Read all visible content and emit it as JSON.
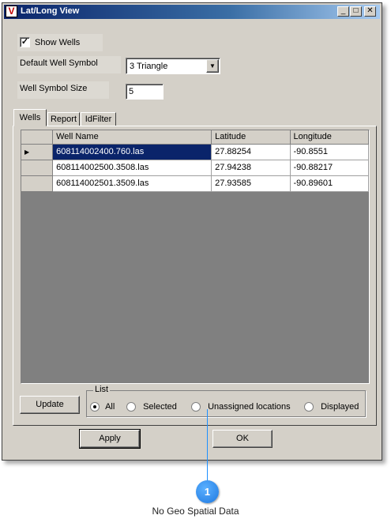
{
  "window": {
    "title": "Lat/Long View",
    "app_icon": "V",
    "minimize_glyph": "_",
    "maximize_glyph": "□",
    "close_glyph": "✕"
  },
  "show_wells": {
    "label": "Show Wells",
    "checked": true,
    "check_glyph": "✓"
  },
  "default_symbol": {
    "label": "Default Well Symbol",
    "value": "3 Triangle",
    "arrow": "▼"
  },
  "symbol_size": {
    "label": "Well Symbol Size",
    "value": "5"
  },
  "tabs": [
    {
      "label": "Wells",
      "active": true
    },
    {
      "label": "Report",
      "active": false
    },
    {
      "label": "IdFilter",
      "active": false
    }
  ],
  "grid": {
    "columns": [
      "Well Name",
      "Latitude",
      "Longitude"
    ],
    "rows": [
      {
        "name": "608114002400.760.las",
        "lat": "27.88254",
        "lon": "-90.8551",
        "current": true
      },
      {
        "name": "608114002500.3508.las",
        "lat": "27.94238",
        "lon": "-90.88217",
        "current": false
      },
      {
        "name": "608114002501.3509.las",
        "lat": "27.93585",
        "lon": "-90.89601",
        "current": false
      }
    ],
    "row_pointer": "▶"
  },
  "update_button": "Update",
  "list_group": {
    "title": "List",
    "options": [
      "All",
      "Selected",
      "Unassigned locations",
      "Displayed"
    ],
    "selected": "All"
  },
  "apply_button": "Apply",
  "ok_button": "OK",
  "callout": {
    "number": "1",
    "caption": "No Geo Spatial Data",
    "color": "#1e90ff"
  }
}
